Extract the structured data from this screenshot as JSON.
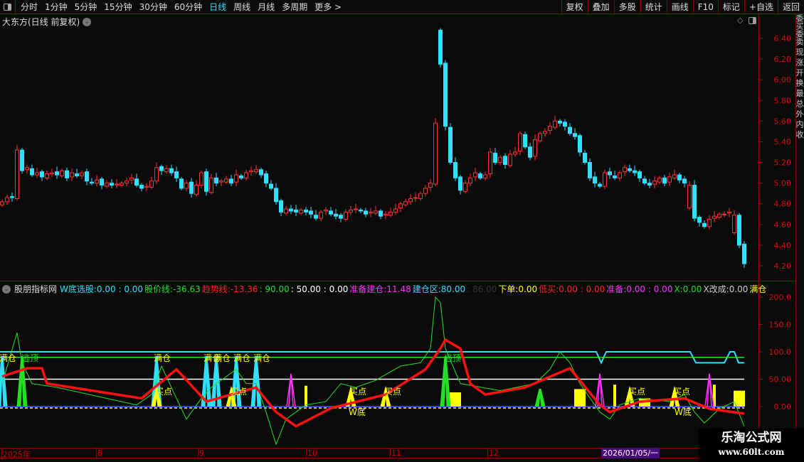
{
  "toolbar": {
    "periods": [
      "分时",
      "1分钟",
      "5分钟",
      "15分钟",
      "30分钟",
      "60分钟",
      "日线",
      "周线",
      "月线",
      "多周期",
      "更多 >"
    ],
    "active_period": "日线",
    "buttons": [
      "复权",
      "叠加",
      "多股",
      "统计",
      "画线",
      "F10",
      "标记",
      "+自选",
      "返回"
    ]
  },
  "main": {
    "title": "大东方(日线 前复权)",
    "price_ticks": [
      "6.40",
      "6.20",
      "6.00",
      "5.80",
      "5.60",
      "5.40",
      "5.20",
      "5.00",
      "4.80",
      "4.60",
      "4.40",
      "4.20"
    ]
  },
  "indicator": {
    "name": "股朋指标网",
    "fields": [
      {
        "label": "W底选股:",
        "value": "0.00 : 0.00",
        "color": "#2fe0ff"
      },
      {
        "label": "股价线:",
        "value": "-36.63",
        "color": "#22e022"
      },
      {
        "label": "趋势线:",
        "value": "-13.36",
        "color": "#ff2020"
      },
      {
        "label": "",
        "value": ": 90.00",
        "color": "#22e022"
      },
      {
        "label": "",
        "value": ": 50.00 : 0.00",
        "color": "#ffffff"
      },
      {
        "label": "准备建仓:",
        "value": "11.48",
        "color": "#ff30ff"
      },
      {
        "label": "建仓区:",
        "value": "80.00",
        "color": "#2fe0ff"
      },
      {
        "label": "",
        "value": ": 86.00",
        "color": "#333333"
      },
      {
        "label": "下单:",
        "value": "0.00",
        "color": "#ffff00"
      },
      {
        "label": "低买:",
        "value": "0.00 : 0.00",
        "color": "#ff2020"
      },
      {
        "label": "准备:",
        "value": "0.00 : 0.00",
        "color": "#ff30ff"
      },
      {
        "label": "X:",
        "value": "0.00",
        "color": "#22e022"
      },
      {
        "label": "X改成:",
        "value": "0.00",
        "color": "#cccccc"
      },
      {
        "label": "满仓",
        "value": "",
        "color": "#ffff00"
      }
    ],
    "ticks": [
      "200.0",
      "150.0",
      "100.0",
      "50.00",
      "0.00"
    ],
    "labels": {
      "full": "满仓",
      "top": "逃顶",
      "buy": "买点",
      "wbottom": "W底"
    }
  },
  "dates": {
    "labels": [
      "2025年",
      "8",
      "9",
      "10",
      "11",
      "12"
    ],
    "selected": "2026/01/05/一"
  },
  "side_text": "委买委卖 现 涨 开 换 最 总 外 内 收",
  "watermark": {
    "name": "乐淘公式网",
    "url": "www.60lt.com"
  },
  "chart_data": {
    "type": "candlestick",
    "price_range": [
      4.2,
      6.4
    ],
    "closes": [
      4.82,
      4.86,
      4.86,
      5.32,
      5.12,
      5.15,
      5.08,
      5.1,
      5.06,
      5.09,
      5.1,
      5.08,
      5.12,
      5.05,
      5.1,
      5.07,
      5.1,
      5.02,
      5.0,
      5.03,
      4.98,
      5.0,
      4.98,
      4.99,
      5.0,
      5.02,
      5.05,
      4.98,
      4.95,
      4.97,
      5.02,
      5.15,
      5.12,
      5.14,
      5.1,
      5.05,
      4.95,
      5.0,
      4.9,
      4.98,
      5.1,
      4.92,
      5.05,
      5.0,
      5.02,
      5.04,
      5.0,
      5.08,
      5.05,
      5.1,
      5.12,
      5.13,
      5.08,
      5.0,
      4.95,
      4.82,
      4.72,
      4.75,
      4.73,
      4.72,
      4.74,
      4.72,
      4.7,
      4.66,
      4.72,
      4.74,
      4.7,
      4.68,
      4.66,
      4.72,
      4.74,
      4.75,
      4.73,
      4.7,
      4.72,
      4.73,
      4.68,
      4.7,
      4.72,
      4.75,
      4.8,
      4.82,
      4.85,
      4.86,
      4.9,
      4.95,
      5.0,
      5.58,
      6.15,
      5.55,
      5.2,
      5.05,
      4.93,
      5.0,
      5.05,
      5.1,
      5.05,
      5.08,
      5.3,
      5.2,
      5.25,
      5.18,
      5.28,
      5.3,
      5.48,
      5.35,
      5.25,
      5.42,
      5.48,
      5.5,
      5.55,
      5.6,
      5.58,
      5.55,
      5.48,
      5.45,
      5.3,
      5.2,
      5.05,
      5.0,
      4.97,
      5.1,
      5.08,
      5.05,
      5.1,
      5.15,
      5.12,
      5.1,
      5.05,
      5.0,
      4.98,
      5.02,
      5.05,
      5.0,
      5.06,
      5.08,
      5.03,
      5.0,
      4.98,
      4.66,
      4.62,
      4.58,
      4.65,
      4.68,
      4.7,
      4.7,
      4.72,
      4.69,
      4.4,
      4.22
    ],
    "open_overrides": {
      "3": 4.85,
      "88": 6.48,
      "138": 4.76,
      "147": 4.52
    },
    "indicator": {
      "range": [
        -50,
        210
      ],
      "trend_line": [
        [
          0,
          55
        ],
        [
          5,
          70
        ],
        [
          8,
          70
        ],
        [
          9,
          42
        ],
        [
          28,
          15
        ],
        [
          35,
          68
        ],
        [
          41,
          9
        ],
        [
          51,
          35
        ],
        [
          55,
          -10
        ],
        [
          59,
          -36
        ],
        [
          66,
          -3
        ],
        [
          77,
          22
        ],
        [
          85,
          68
        ],
        [
          88,
          106
        ],
        [
          89,
          122
        ],
        [
          92,
          106
        ],
        [
          94,
          42
        ],
        [
          97,
          22
        ],
        [
          105,
          35
        ],
        [
          114,
          70
        ],
        [
          120,
          3
        ],
        [
          122,
          -10
        ],
        [
          128,
          9
        ],
        [
          137,
          15
        ],
        [
          142,
          -4
        ],
        [
          149,
          -13
        ]
      ],
      "price_line": [
        [
          0,
          42
        ],
        [
          3,
          135
        ],
        [
          4,
          80
        ],
        [
          6,
          42
        ],
        [
          11,
          35
        ],
        [
          21,
          15
        ],
        [
          27,
          3
        ],
        [
          30,
          22
        ],
        [
          32,
          74
        ],
        [
          35,
          15
        ],
        [
          37,
          -23
        ],
        [
          40,
          15
        ],
        [
          42,
          35
        ],
        [
          47,
          68
        ],
        [
          49,
          42
        ],
        [
          51,
          42
        ],
        [
          53,
          -10
        ],
        [
          55,
          -69
        ],
        [
          57,
          -23
        ],
        [
          61,
          3
        ],
        [
          65,
          9
        ],
        [
          68,
          42
        ],
        [
          71,
          35
        ],
        [
          75,
          48
        ],
        [
          80,
          74
        ],
        [
          84,
          80
        ],
        [
          86,
          106
        ],
        [
          87,
          200
        ],
        [
          88,
          190
        ],
        [
          89,
          106
        ],
        [
          92,
          42
        ],
        [
          100,
          29
        ],
        [
          107,
          42
        ],
        [
          110,
          68
        ],
        [
          112,
          100
        ],
        [
          114,
          80
        ],
        [
          116,
          42
        ],
        [
          120,
          -10
        ],
        [
          122,
          -23
        ],
        [
          124,
          3
        ],
        [
          128,
          15
        ],
        [
          134,
          9
        ],
        [
          137,
          22
        ],
        [
          139,
          -10
        ],
        [
          141,
          -30
        ],
        [
          144,
          -4
        ],
        [
          147,
          9
        ],
        [
          149,
          -36
        ]
      ],
      "w_spikes": [
        0,
        31,
        41,
        43,
        47,
        51
      ],
      "top_spikes": [
        4,
        89,
        108
      ],
      "buy_points": [
        31,
        46,
        70,
        77,
        126,
        135
      ],
      "magenta_spikes": [
        58,
        120,
        142
      ],
      "bars": [
        [
          91,
          26
        ],
        [
          116,
          32
        ],
        [
          129,
          15
        ],
        [
          148,
          29
        ]
      ],
      "thin_bars": [
        [
          61,
          38
        ],
        [
          123,
          40
        ],
        [
          143,
          40
        ]
      ],
      "levels": {
        "cyan": 100,
        "green": 90,
        "white": 50,
        "zero": 0
      }
    }
  }
}
